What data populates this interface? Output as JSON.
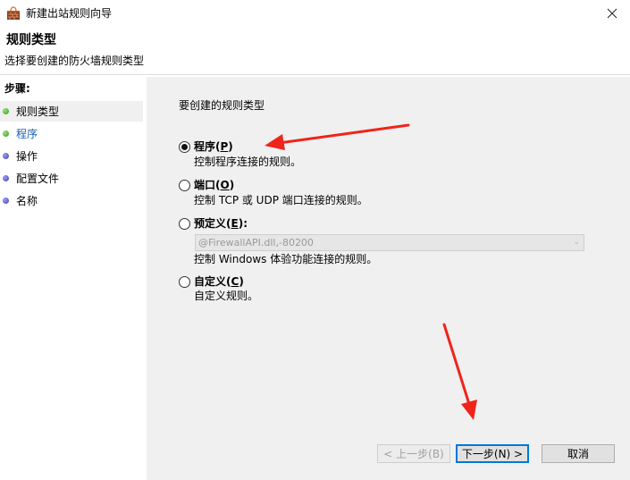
{
  "window": {
    "title": "新建出站规则向导",
    "close_glyph": "✕"
  },
  "header": {
    "title": "规则类型",
    "subtitle": "选择要创建的防火墙规则类型"
  },
  "sidebar": {
    "steps_label": "步骤:",
    "items": [
      {
        "label": "规则类型",
        "status": "green",
        "active": true
      },
      {
        "label": "程序",
        "status": "green",
        "active": false
      },
      {
        "label": "操作",
        "status": "blue",
        "active": false
      },
      {
        "label": "配置文件",
        "status": "blue",
        "active": false
      },
      {
        "label": "名称",
        "status": "blue",
        "active": false
      }
    ]
  },
  "main": {
    "prompt": "要创建的规则类型",
    "options": [
      {
        "label": "程序",
        "accel": "P",
        "description": "控制程序连接的规则。",
        "checked": true
      },
      {
        "label": "端口",
        "accel": "O",
        "description": "控制 TCP 或 UDP 端口连接的规则。",
        "checked": false
      },
      {
        "label": "预定义",
        "accel": "E",
        "description": "控制 Windows 体验功能连接的规则。",
        "checked": false
      },
      {
        "label": "自定义",
        "accel": "C",
        "description": "自定义规则。",
        "checked": false
      }
    ],
    "predefined_select": {
      "value": "@FirewallAPI.dll,-80200",
      "disabled": true
    }
  },
  "buttons": {
    "back": "< 上一步(B)",
    "next": "下一步(N) >",
    "cancel": "取消"
  },
  "colors": {
    "annotation_arrow": "#f0241b",
    "content_bg": "#f0f0f0",
    "link": "#1a5fb4"
  }
}
